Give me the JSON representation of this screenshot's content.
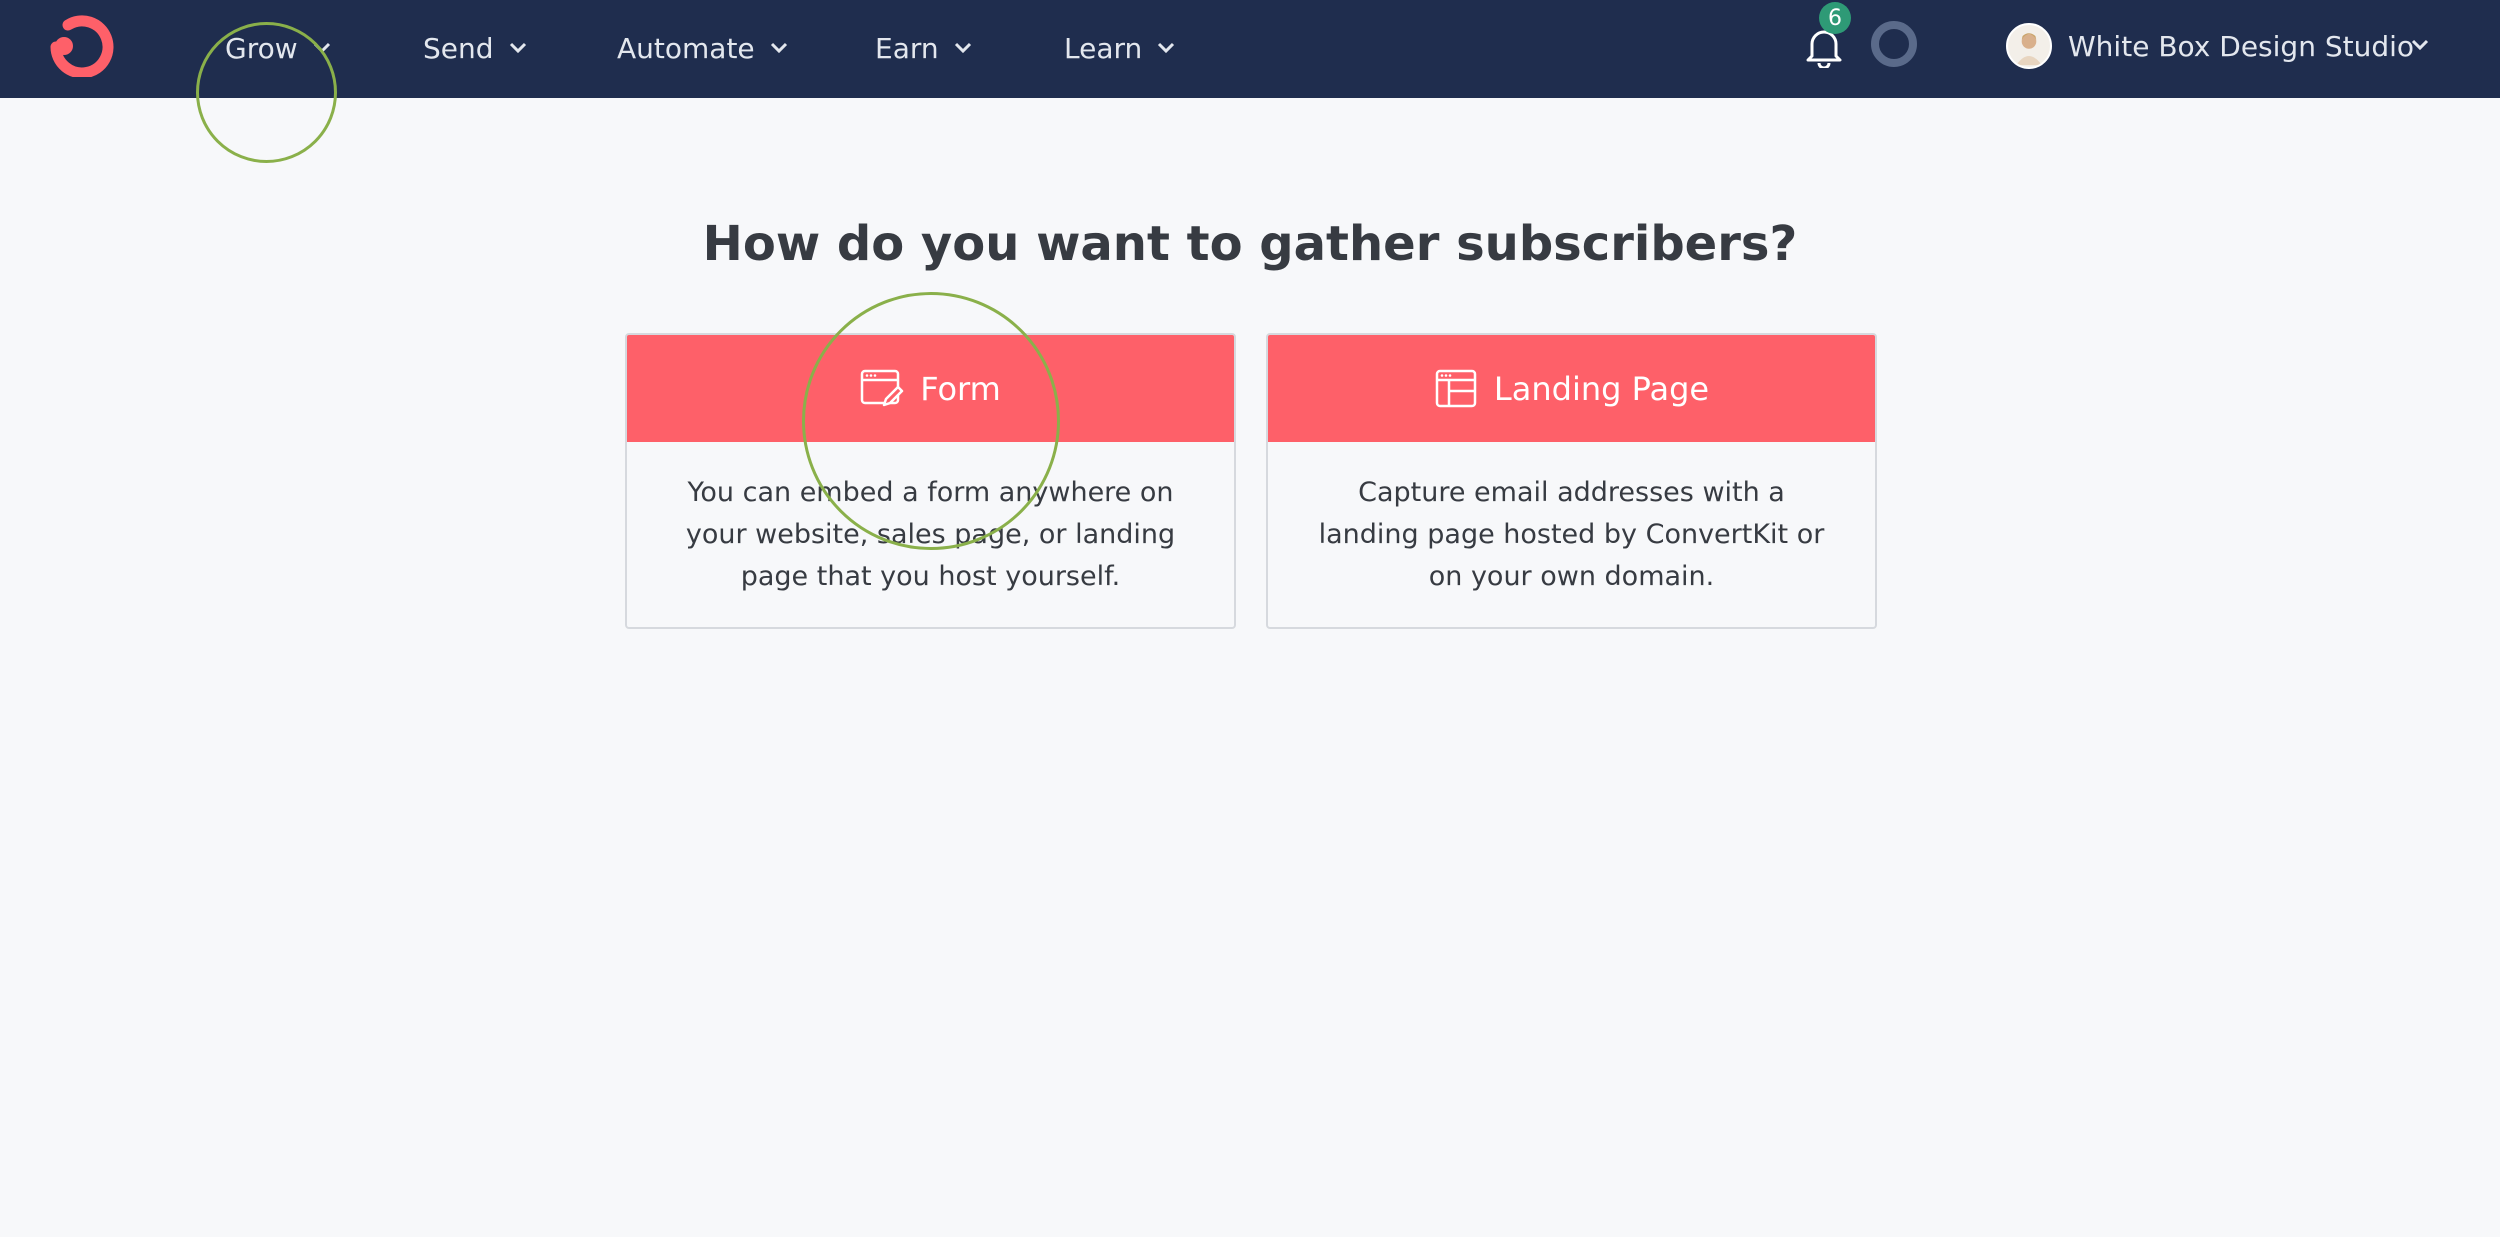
{
  "nav": {
    "items": [
      {
        "label": "Grow"
      },
      {
        "label": "Send"
      },
      {
        "label": "Automate"
      },
      {
        "label": "Earn"
      },
      {
        "label": "Learn"
      }
    ],
    "notifications": {
      "count": "6"
    },
    "account": {
      "name": "White Box Design Studio"
    }
  },
  "main": {
    "title": "How do you want to gather subscribers?",
    "options": [
      {
        "label": "Form",
        "icon": "form-edit-icon",
        "description": "You can embed a form anywhere on your website, sales page, or landing page that you host yourself."
      },
      {
        "label": "Landing Page",
        "icon": "landing-page-layout-icon",
        "description": "Capture email addresses with a landing page hosted by ConvertKit or on your own domain."
      }
    ]
  },
  "colors": {
    "topbar": "#1f2d4e",
    "accent": "#fe6069",
    "badge": "#2e9a76",
    "highlight": "#8ab04a",
    "background": "#f7f8fa"
  },
  "icons": [
    "convertkit-logo-icon",
    "chevron-down-icon",
    "bell-icon",
    "loading-ring-icon",
    "avatar",
    "form-edit-icon",
    "landing-page-layout-icon"
  ]
}
